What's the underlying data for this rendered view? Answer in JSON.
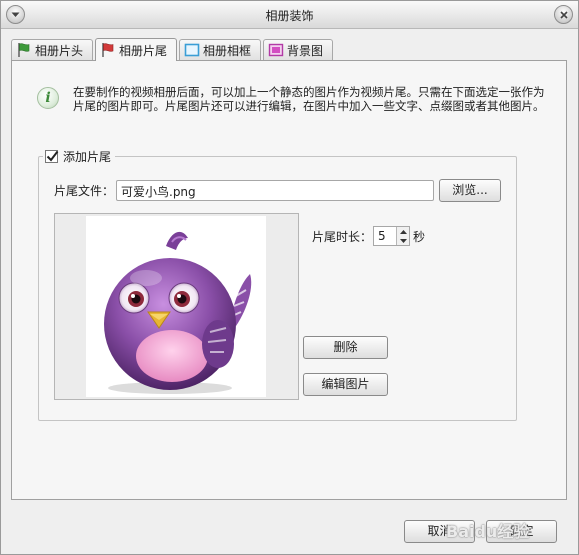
{
  "window": {
    "title": "相册装饰"
  },
  "tabs": [
    {
      "label": "相册片头",
      "icon": "flag-green-icon"
    },
    {
      "label": "相册片尾",
      "icon": "flag-red-icon",
      "active": true
    },
    {
      "label": "相册相框",
      "icon": "frame-icon"
    },
    {
      "label": "背景图",
      "icon": "picture-icon"
    }
  ],
  "info": {
    "icon": "info-icon",
    "text": "在要制作的视频相册后面，可以加上一个静态的图片作为视频片尾。只需在下面选定一张作为片尾的图片即可。片尾图片还可以进行编辑，在图片中加入一些文字、点缀图或者其他图片。"
  },
  "ending": {
    "checkbox_label": "添加片尾",
    "checked": true,
    "file_label": "片尾文件：",
    "file_value": "可爱小鸟.png",
    "browse_label": "浏览...",
    "duration_label": "片尾时长：",
    "duration_value": "5",
    "duration_unit": "秒",
    "delete_label": "删除",
    "edit_label": "编辑图片",
    "preview_image": "purple-bird-image"
  },
  "footer": {
    "cancel_label": "取消",
    "ok_label": "确定",
    "watermark": "Baidu经验"
  },
  "colors": {
    "window_bg": "#efefef",
    "panel_bg": "#f6f6f6",
    "info_green": "#3d8a3a",
    "bird_purple": "#8a4fa8"
  }
}
